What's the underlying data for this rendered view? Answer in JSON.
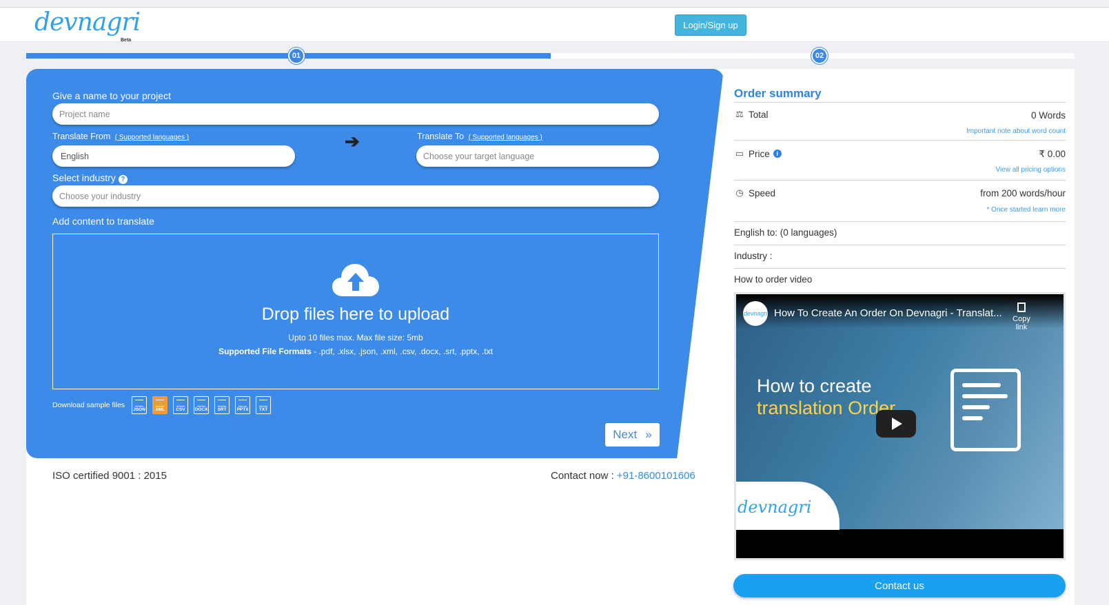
{
  "header": {
    "logo_text": "devnagri",
    "logo_badge": "Beta",
    "login_label": "Login/Sign up"
  },
  "progress": {
    "step1": "01",
    "step2": "02",
    "completed_fraction": 0.5
  },
  "form": {
    "project_label": "Give a name to your project",
    "project_placeholder": "Project name",
    "translate_from_label": "Translate From",
    "translate_from_link": "( Supported languages )",
    "translate_from_value": "English",
    "translate_to_label": "Translate To",
    "translate_to_link": "( Supported languages )",
    "translate_to_placeholder": "Choose your target language",
    "industry_label": "Select industry",
    "industry_placeholder": "Choose your industry",
    "content_label": "Add content to translate",
    "drop_title": "Drop files here to upload",
    "drop_info": "Upto 10 files max. Max file size: 5mb",
    "drop_formats_label": "Supported File Formats",
    "drop_formats_list": " - .pdf, .xlsx, .json, .xml, .csv, .docx, .srt, .pptx, .txt",
    "samples_label": "Download sample files",
    "sample_files": [
      "JSON",
      "XML",
      "CSV",
      "DOCX",
      "SRT",
      "PPTX",
      "TXT"
    ],
    "next_label": "Next",
    "next_icon": "»"
  },
  "footer": {
    "iso": "ISO certified 9001 : 2015",
    "contact_label": "Contact now : ",
    "contact_phone": "+91-8600101606"
  },
  "summary": {
    "title": "Order summary",
    "total_label": "Total",
    "total_value": "0 Words",
    "total_note": "Important note about word count",
    "price_label": "Price",
    "price_value": "₹ 0.00",
    "price_note": "View all pricing options",
    "speed_label": "Speed",
    "speed_value": "from 200 words/hour",
    "speed_note": "* Once started learn more",
    "languages": "English to: (0 languages)",
    "industry": "Industry :",
    "video_label": "How to order video",
    "contact_button": "Contact us"
  },
  "video": {
    "channel": "devnagri",
    "title": "How To Create An Order On Devnagri - Translat...",
    "copy_link": "Copy link",
    "headline_1": "How to create",
    "headline_2": "translation Order",
    "watermark": "devnagri"
  },
  "colors": {
    "panel_blue": "#3d8be8",
    "link_blue": "#2f82dd",
    "contact_button": "#1aa0f0",
    "login_button": "#45b5e0"
  }
}
